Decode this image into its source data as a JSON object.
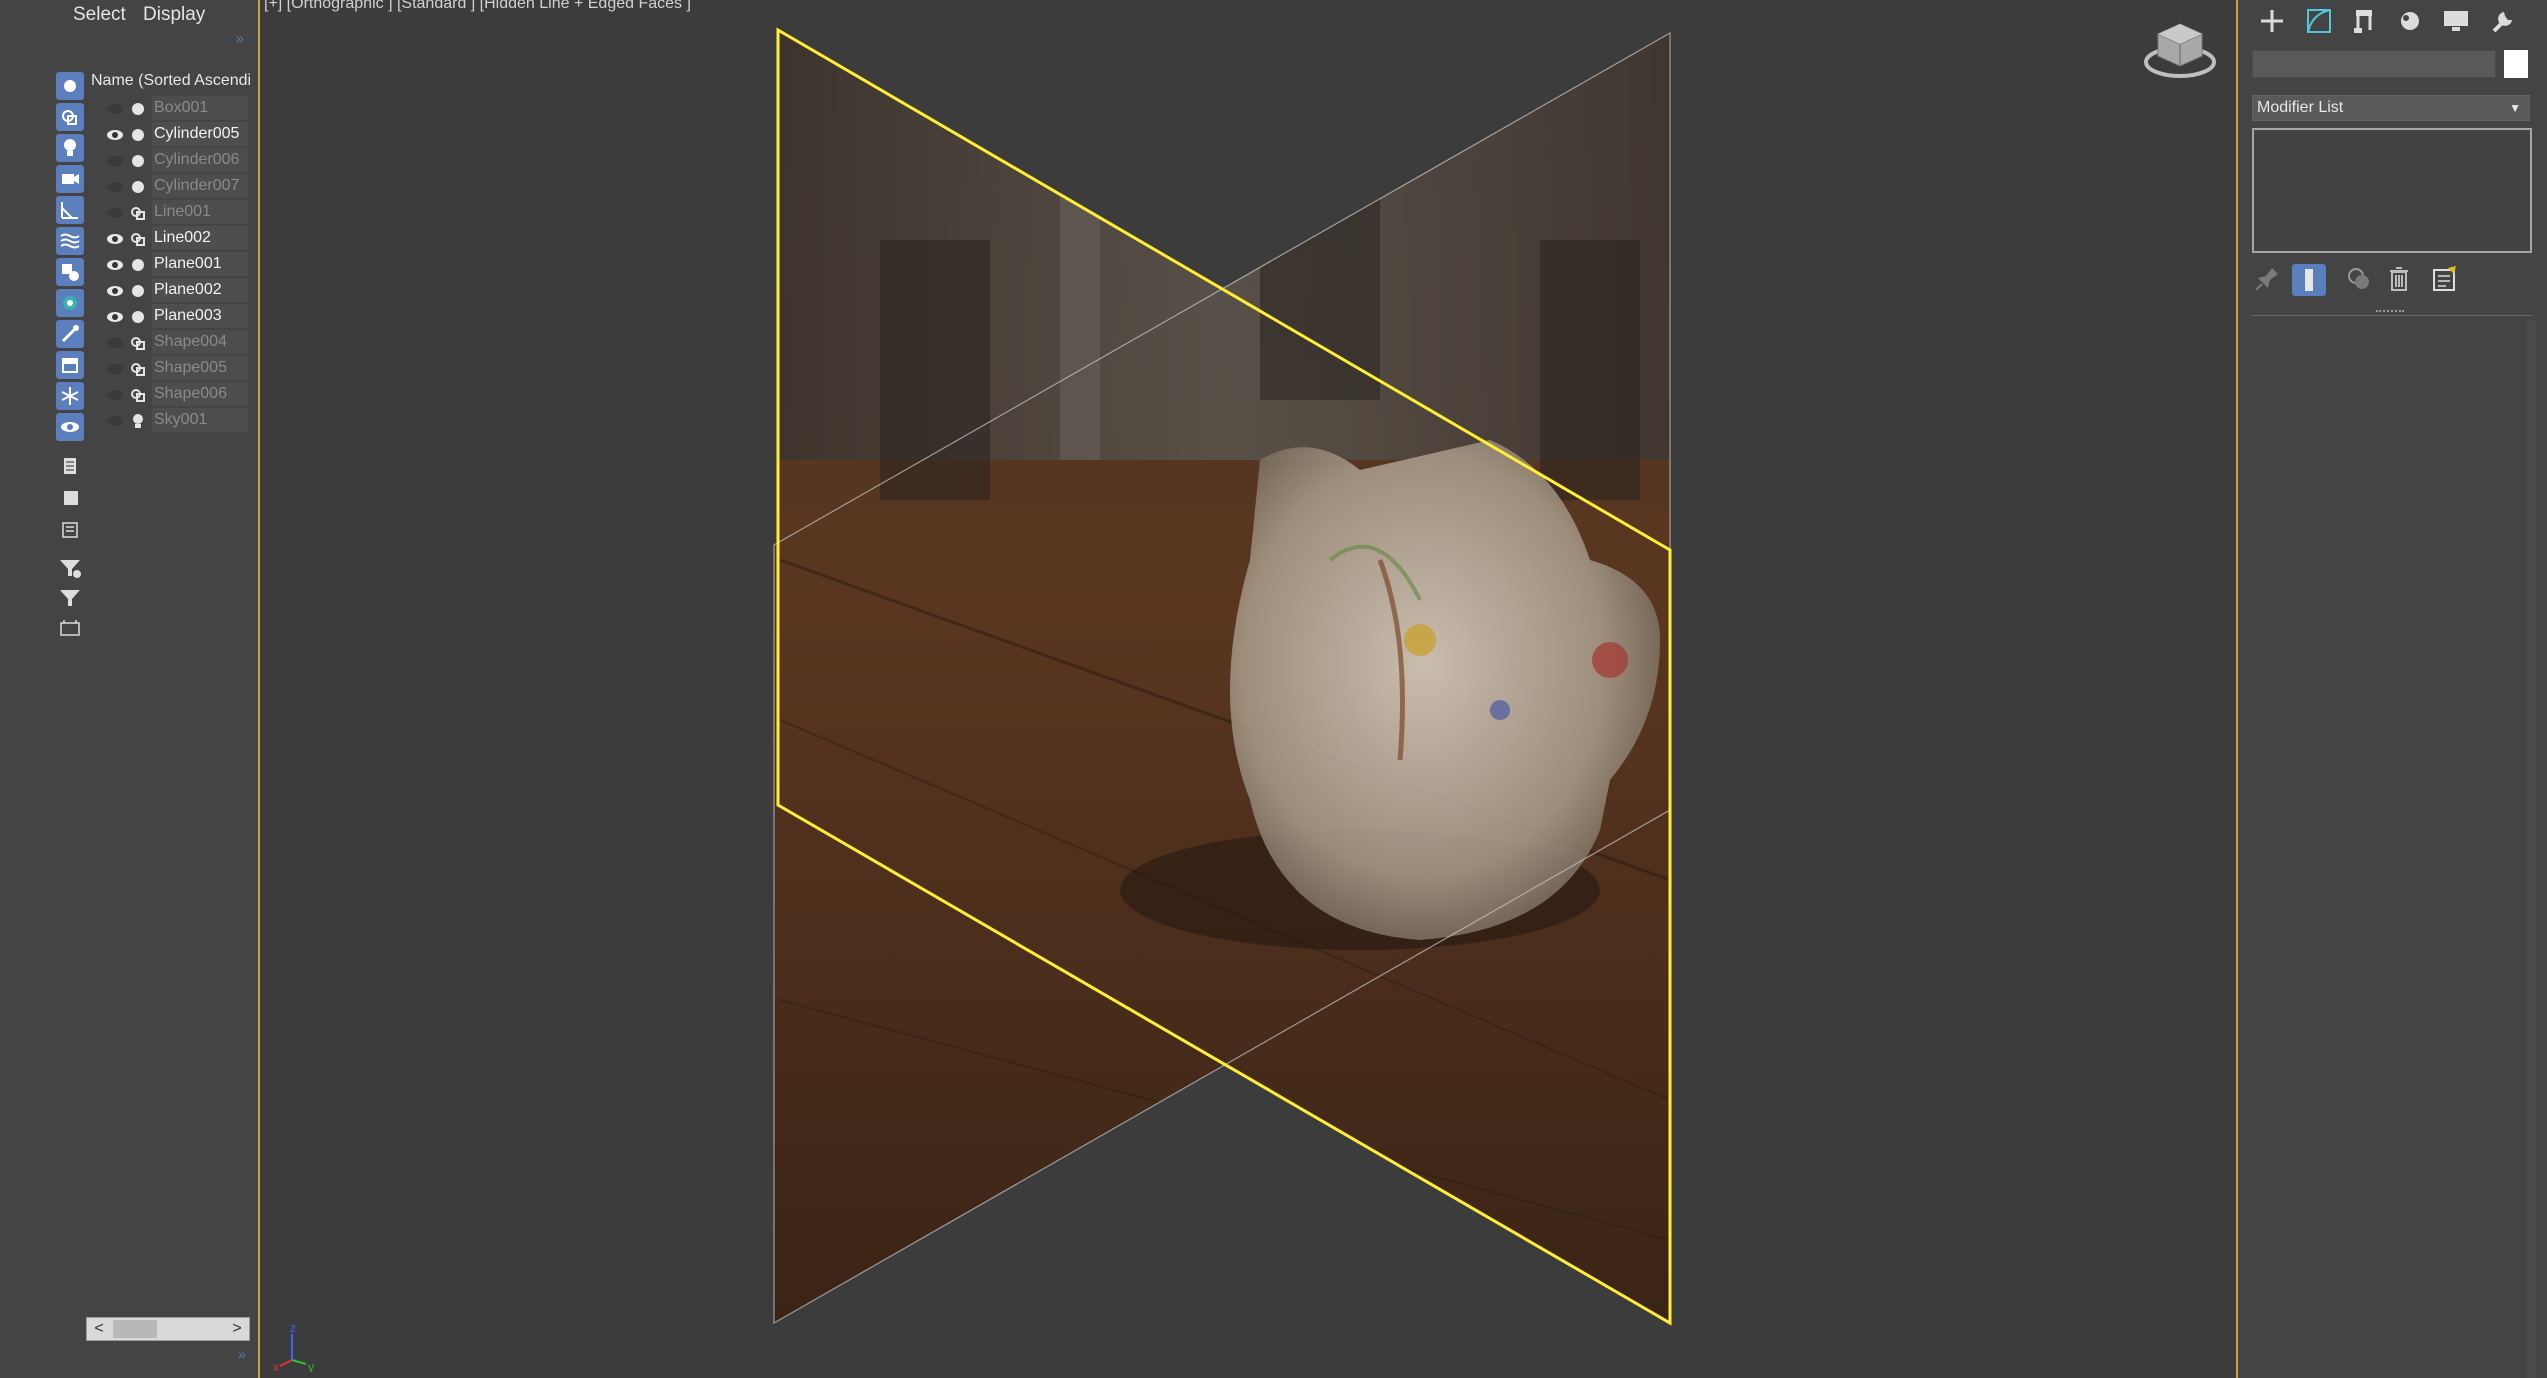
{
  "explorer": {
    "menu": {
      "select": "Select",
      "display": "Display"
    },
    "collapse_arrow": "»",
    "column_header": "Name (Sorted Ascendi",
    "objects": [
      {
        "name": "Box001",
        "visible": false,
        "type": "geometry"
      },
      {
        "name": "Cylinder005",
        "visible": true,
        "type": "geometry"
      },
      {
        "name": "Cylinder006",
        "visible": false,
        "type": "geometry"
      },
      {
        "name": "Cylinder007",
        "visible": false,
        "type": "geometry"
      },
      {
        "name": "Line001",
        "visible": false,
        "type": "shape"
      },
      {
        "name": "Line002",
        "visible": true,
        "type": "shape"
      },
      {
        "name": "Plane001",
        "visible": true,
        "type": "geometry"
      },
      {
        "name": "Plane002",
        "visible": true,
        "type": "geometry"
      },
      {
        "name": "Plane003",
        "visible": true,
        "type": "geometry"
      },
      {
        "name": "Shape004",
        "visible": false,
        "type": "shape"
      },
      {
        "name": "Shape005",
        "visible": false,
        "type": "shape"
      },
      {
        "name": "Shape006",
        "visible": false,
        "type": "shape"
      },
      {
        "name": "Sky001",
        "visible": false,
        "type": "light"
      }
    ],
    "scroll_left": "<",
    "scroll_right": ">"
  },
  "viewport": {
    "label": "[+] [Orthographic ] [Standard ] [Hidden Line + Edged Faces ]",
    "selection_color": "#ffee33",
    "axis_labels": {
      "x": "x",
      "y": "y",
      "z": "z"
    }
  },
  "command_panel": {
    "tabs": [
      "create-icon",
      "modify-icon",
      "hierarchy-icon",
      "motion-icon",
      "display-icon",
      "utilities-icon"
    ],
    "object_color": "#ffffff",
    "modifier_list_label": "Modifier List",
    "dropdown_arrow": "▼"
  },
  "colors": {
    "accent_blue": "#5b7fbd",
    "viewport_border": "#c9a545",
    "modify_tab_accent": "#4fc8d8"
  }
}
